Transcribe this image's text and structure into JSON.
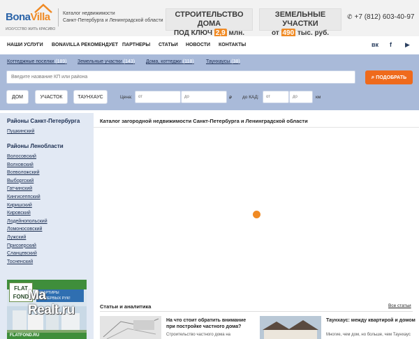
{
  "header": {
    "logo_text_main": "Bona",
    "logo_text_accent": "Villa",
    "logo_tagline": "ИСКУССТВО ЖИТЬ КРАСИВО",
    "catalog_line1": "Каталог недвижимости",
    "catalog_line2": "Санкт-Петербурга и Ленинградской области",
    "promo1": {
      "line1": "СТРОИТЕЛЬСТВО ДОМА",
      "line2_pre": "ПОД КЛЮЧ",
      "line2_hl": "2,9",
      "line2_post": "млн. руб."
    },
    "promo2": {
      "line1": "ЗЕМЕЛЬНЫЕ УЧАСТКИ",
      "line2_pre": "от",
      "line2_hl": "490",
      "line2_post": "тыс. руб."
    },
    "phone": "+7 (812) 603-40-97"
  },
  "nav": {
    "items": [
      "НАШИ УСЛУГИ",
      "BONAVILLA РЕКОМЕНДУЕТ",
      "ПАРТНЕРЫ",
      "СТАТЬИ",
      "НОВОСТИ",
      "КОНТАКТЫ"
    ],
    "social": [
      "вк",
      "f",
      "▶"
    ]
  },
  "search": {
    "tabs": [
      {
        "label": "Коттеджные поселки",
        "count": "(189)"
      },
      {
        "label": "Земельные участки",
        "count": "(143)"
      },
      {
        "label": "Дома, коттеджи",
        "count": "(118)"
      },
      {
        "label": "Таунхаусы",
        "count": "(38)"
      }
    ],
    "placeholder": "Введите название КП или района",
    "button_label": "ПОДОБРАТЬ",
    "types": [
      "ДОМ",
      "УЧАСТОК",
      "ТАУНХАУС"
    ],
    "price_label": "Цена:",
    "from_ph": "от",
    "to_ph": "до",
    "currency": "₽",
    "kad_label": "до КАД:",
    "km": "км"
  },
  "sidebar": {
    "spb_head": "Районы Санкт-Петербурга",
    "spb_items": [
      "Пушкинский"
    ],
    "lo_head": "Районы Ленобласти",
    "lo_items": [
      "Волосовский",
      "Волховский",
      "Всеволожский",
      "Выборгский",
      "Гатчинский",
      "Кингисеппский",
      "Киришский",
      "Кировский",
      "Лодейнопольский",
      "Ломоносовский",
      "Лужский",
      "Приозерский",
      "Сланцевский",
      "Тосненский"
    ],
    "banner": {
      "logo": "FLAT FOND",
      "tag_line1": "КВАРТИРЫ",
      "tag_line2": "ИЗ ПЕРВЫХ РУК!",
      "url": "FLATFOND.RU"
    },
    "watermark_top": "Ma",
    "watermark": "Realt.ru"
  },
  "main": {
    "title": "Каталог загородной недвижимости Санкт-Петербурга и Ленинградской области",
    "articles_head": "Статьи и аналитика",
    "articles_all": "Все статьи",
    "articles": [
      {
        "title": "На что стоит обратить внимание при постройке частного дома?",
        "text": "Строительство частного дома на"
      },
      {
        "title": "Таунхаус: между квартирой и домом",
        "text": "Многие, чем дом, но больше, чем Таунхаус"
      }
    ]
  },
  "colors": {
    "accent": "#ef6a1c",
    "panel": "#a9bad9",
    "sidebar": "#e2e9f4",
    "brand_blue": "#2a63a8"
  }
}
